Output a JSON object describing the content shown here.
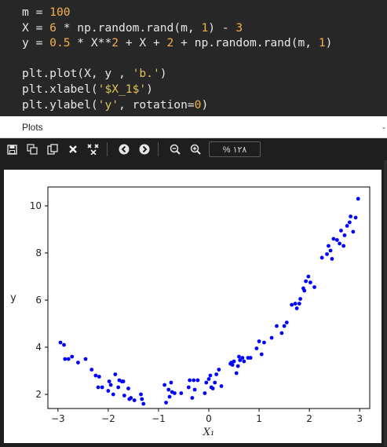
{
  "code": {
    "lines": [
      [
        {
          "t": "m = ",
          "c": ""
        },
        {
          "t": "100",
          "c": "num"
        }
      ],
      [
        {
          "t": "X = ",
          "c": ""
        },
        {
          "t": "6",
          "c": "num"
        },
        {
          "t": " * np.random.rand(m, ",
          "c": ""
        },
        {
          "t": "1",
          "c": "num"
        },
        {
          "t": ") - ",
          "c": ""
        },
        {
          "t": "3",
          "c": "num"
        }
      ],
      [
        {
          "t": "y = ",
          "c": ""
        },
        {
          "t": "0.5",
          "c": "num"
        },
        {
          "t": " * X**",
          "c": ""
        },
        {
          "t": "2",
          "c": "num"
        },
        {
          "t": " + X + ",
          "c": ""
        },
        {
          "t": "2",
          "c": "num"
        },
        {
          "t": " + np.random.rand(m, ",
          "c": ""
        },
        {
          "t": "1",
          "c": "num"
        },
        {
          "t": ")",
          "c": ""
        }
      ],
      [],
      [
        {
          "t": "plt.plot(X, y , ",
          "c": ""
        },
        {
          "t": "'b.'",
          "c": "str"
        },
        {
          "t": ")",
          "c": ""
        }
      ],
      [
        {
          "t": "plt.xlabel(",
          "c": ""
        },
        {
          "t": "'$X_1$'",
          "c": "str"
        },
        {
          "t": ")",
          "c": ""
        }
      ],
      [
        {
          "t": "plt.ylabel(",
          "c": ""
        },
        {
          "t": "'y'",
          "c": "str"
        },
        {
          "t": ", rotation=",
          "c": ""
        },
        {
          "t": "0",
          "c": "num"
        },
        {
          "t": ")",
          "c": ""
        }
      ]
    ]
  },
  "panel": {
    "title": "Plots",
    "dash": "-"
  },
  "toolbar": {
    "icons": [
      "save-icon",
      "save-all-icon",
      "copy-icon",
      "close-icon",
      "close-all-icon",
      "back-icon",
      "forward-icon",
      "zoom-out-icon",
      "zoom-in-icon"
    ],
    "zoom_text": "١٢٨ %"
  },
  "chart_data": {
    "type": "scatter",
    "marker_color": "#0000ff",
    "xlabel": "X₁",
    "ylabel": "y",
    "xlim": [
      -3.2,
      3.2
    ],
    "ylim": [
      1.4,
      10.8
    ],
    "xticks": [
      -3,
      -2,
      -1,
      0,
      1,
      2,
      3
    ],
    "yticks": [
      2,
      4,
      6,
      8,
      10
    ],
    "grid": false,
    "points": [
      [
        -2.95,
        4.2
      ],
      [
        -2.88,
        4.1
      ],
      [
        -2.86,
        3.5
      ],
      [
        -2.79,
        3.5
      ],
      [
        -2.72,
        3.6
      ],
      [
        -2.6,
        3.35
      ],
      [
        -2.45,
        3.5
      ],
      [
        -2.33,
        3.05
      ],
      [
        -2.25,
        2.8
      ],
      [
        -2.2,
        2.3
      ],
      [
        -2.18,
        2.75
      ],
      [
        -2.12,
        2.3
      ],
      [
        -2.0,
        2.15
      ],
      [
        -1.98,
        2.55
      ],
      [
        -1.95,
        2.4
      ],
      [
        -1.9,
        2.0
      ],
      [
        -1.86,
        2.85
      ],
      [
        -1.8,
        2.3
      ],
      [
        -1.78,
        2.6
      ],
      [
        -1.73,
        2.55
      ],
      [
        -1.7,
        2.55
      ],
      [
        -1.68,
        1.95
      ],
      [
        -1.6,
        2.25
      ],
      [
        -1.58,
        1.8
      ],
      [
        -1.55,
        1.85
      ],
      [
        -1.48,
        1.75
      ],
      [
        -1.35,
        2.0
      ],
      [
        -1.33,
        1.8
      ],
      [
        -1.3,
        1.6
      ],
      [
        -0.88,
        2.4
      ],
      [
        -0.85,
        1.65
      ],
      [
        -0.8,
        2.2
      ],
      [
        -0.78,
        1.9
      ],
      [
        -0.75,
        2.5
      ],
      [
        -0.73,
        2.1
      ],
      [
        -0.68,
        2.05
      ],
      [
        -0.55,
        2.05
      ],
      [
        -0.4,
        2.3
      ],
      [
        -0.38,
        2.6
      ],
      [
        -0.33,
        1.85
      ],
      [
        -0.3,
        2.6
      ],
      [
        -0.28,
        2.2
      ],
      [
        -0.22,
        2.6
      ],
      [
        -0.08,
        2.05
      ],
      [
        -0.05,
        2.5
      ],
      [
        0.0,
        2.65
      ],
      [
        0.03,
        2.8
      ],
      [
        0.05,
        2.3
      ],
      [
        0.08,
        2.25
      ],
      [
        0.12,
        2.5
      ],
      [
        0.15,
        2.85
      ],
      [
        0.2,
        3.05
      ],
      [
        0.25,
        2.35
      ],
      [
        0.43,
        3.3
      ],
      [
        0.45,
        3.35
      ],
      [
        0.47,
        3.25
      ],
      [
        0.5,
        3.4
      ],
      [
        0.55,
        2.9
      ],
      [
        0.58,
        3.2
      ],
      [
        0.6,
        3.6
      ],
      [
        0.62,
        3.45
      ],
      [
        0.67,
        3.55
      ],
      [
        0.7,
        3.4
      ],
      [
        0.78,
        3.55
      ],
      [
        0.83,
        3.55
      ],
      [
        0.95,
        3.95
      ],
      [
        1.0,
        4.25
      ],
      [
        1.05,
        3.7
      ],
      [
        1.1,
        4.2
      ],
      [
        1.25,
        4.4
      ],
      [
        1.35,
        4.9
      ],
      [
        1.45,
        4.6
      ],
      [
        1.5,
        4.9
      ],
      [
        1.55,
        5.05
      ],
      [
        1.65,
        5.8
      ],
      [
        1.72,
        5.85
      ],
      [
        1.75,
        5.65
      ],
      [
        1.8,
        5.85
      ],
      [
        1.82,
        6.05
      ],
      [
        1.88,
        6.5
      ],
      [
        1.9,
        6.4
      ],
      [
        1.93,
        6.8
      ],
      [
        1.98,
        7.0
      ],
      [
        2.02,
        6.75
      ],
      [
        2.1,
        6.55
      ],
      [
        2.25,
        7.8
      ],
      [
        2.38,
        8.3
      ],
      [
        2.42,
        8.1
      ],
      [
        2.48,
        8.6
      ],
      [
        2.55,
        8.55
      ],
      [
        2.6,
        8.4
      ],
      [
        2.63,
        8.95
      ],
      [
        2.68,
        8.3
      ],
      [
        2.7,
        8.75
      ],
      [
        2.75,
        9.15
      ],
      [
        2.8,
        9.3
      ],
      [
        2.82,
        9.55
      ],
      [
        2.87,
        8.9
      ],
      [
        2.92,
        9.5
      ],
      [
        2.97,
        10.3
      ],
      [
        2.45,
        7.75
      ],
      [
        2.35,
        7.95
      ]
    ]
  }
}
